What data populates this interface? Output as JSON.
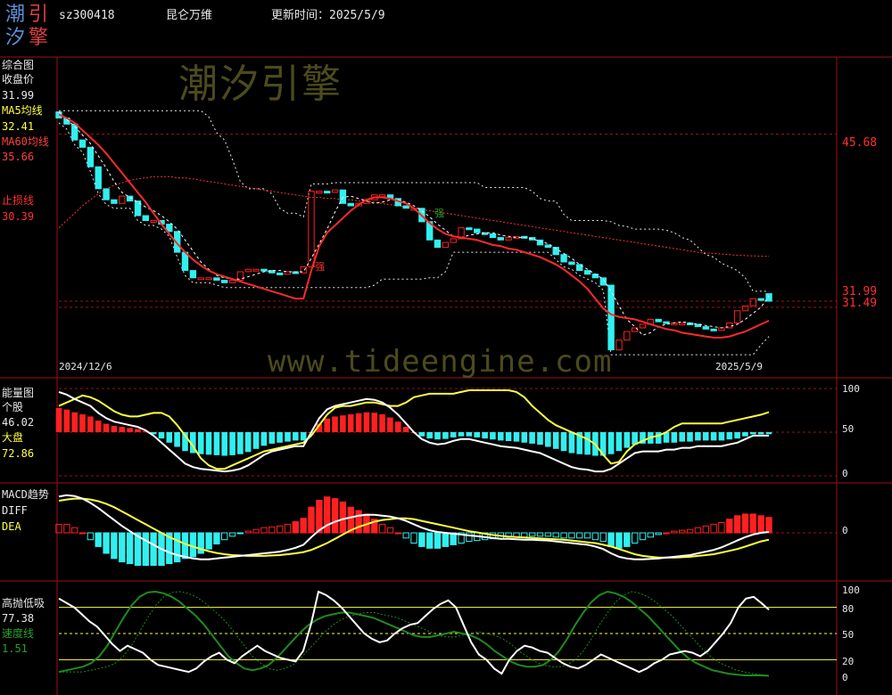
{
  "header": {
    "logo_chars": [
      "潮",
      "引",
      "汐",
      "擎"
    ],
    "code": "sz300418",
    "name": "昆仑万维",
    "update_label": "更新时间：2025/5/9"
  },
  "watermarks": {
    "brand": "潮汐引擎",
    "url": "www.tideengine.com"
  },
  "colors": {
    "up": "#ff2020",
    "down": "#30f0f0",
    "ma5": "#ffffff",
    "ma60": "#ff3030",
    "stop": "#ff2a2a",
    "yellow": "#ffff40",
    "green": "#1f8a1f",
    "grid": "#a01010"
  },
  "panels": {
    "main": {
      "title": "综合图",
      "close_label": "收盘价",
      "close_value": "31.99",
      "ma5_label": "MA5均线",
      "ma5_value": "32.41",
      "ma60_label": "MA60均线",
      "ma60_value": "35.66",
      "stop_label": "止损线",
      "stop_value": "30.39",
      "date_start": "2024/12/6",
      "date_end": "2025/5/9",
      "axis_labels": [
        "45.68",
        "31.99",
        "31.49"
      ],
      "markers": [
        "强",
        "强"
      ]
    },
    "energy": {
      "title": "能量图",
      "stock_label": "个股",
      "stock_value": "46.02",
      "market_label": "大盘",
      "market_value": "72.86",
      "axis_labels": [
        "100",
        "50",
        "0"
      ]
    },
    "macd": {
      "title": "MACD趋势",
      "diff_label": "DIFF",
      "dea_label": "DEA",
      "axis_labels": [
        "0"
      ]
    },
    "osc": {
      "title": "高抛低吸",
      "value": "77.38",
      "speed_label": "速度线",
      "speed_value": "1.51",
      "axis_labels": [
        "100",
        "80",
        "50",
        "20",
        "0"
      ]
    }
  },
  "chart_data": [
    {
      "type": "candlestick",
      "title": "综合图",
      "x_start": "2024/12/6",
      "x_end": "2025/5/9",
      "ylim": [
        26,
        52
      ],
      "reference_levels": [
        45.68,
        31.99,
        31.49
      ],
      "close": [
        47.0,
        46.5,
        45.2,
        44.6,
        43.0,
        41.2,
        40.3,
        40.0,
        40.6,
        40.2,
        39.0,
        38.6,
        38.6,
        38.3,
        37.7,
        36.0,
        34.5,
        33.9,
        33.9,
        33.9,
        33.7,
        33.5,
        33.7,
        34.4,
        34.6,
        34.6,
        34.5,
        34.3,
        34.2,
        34.4,
        34.3,
        34.8,
        41.0,
        41.0,
        40.9,
        41.1,
        40.0,
        39.8,
        40.0,
        40.3,
        40.7,
        40.7,
        40.4,
        39.8,
        39.6,
        39.6,
        38.5,
        37.0,
        36.4,
        36.8,
        37.1,
        38.0,
        37.9,
        37.6,
        37.5,
        37.2,
        37.0,
        37.2,
        37.3,
        37.2,
        37.0,
        36.6,
        36.4,
        35.8,
        35.2,
        35.0,
        34.5,
        34.2,
        33.9,
        33.3,
        28.0,
        28.8,
        29.5,
        29.8,
        30.1,
        30.5,
        30.3,
        30.2,
        30.2,
        30.2,
        30.1,
        29.9,
        29.7,
        29.6,
        29.8,
        30.2,
        31.2,
        31.6,
        32.2,
        32.1,
        31.99
      ],
      "open": [
        47.5,
        47.0,
        46.5,
        45.2,
        44.6,
        43.0,
        41.2,
        40.3,
        40.0,
        40.6,
        40.2,
        39.0,
        38.6,
        38.6,
        38.3,
        37.7,
        36.0,
        34.5,
        33.9,
        33.9,
        33.9,
        33.7,
        33.5,
        33.7,
        34.4,
        34.6,
        34.6,
        34.5,
        34.3,
        34.2,
        34.4,
        34.3,
        34.8,
        41.0,
        41.0,
        40.9,
        41.1,
        40.0,
        39.8,
        40.0,
        40.3,
        40.7,
        40.7,
        40.4,
        39.8,
        39.6,
        39.6,
        38.5,
        37.0,
        36.4,
        36.8,
        37.1,
        38.0,
        37.9,
        37.6,
        37.5,
        37.2,
        37.0,
        37.2,
        37.3,
        37.2,
        37.0,
        36.6,
        36.4,
        35.8,
        35.2,
        35.0,
        34.5,
        34.2,
        33.9,
        33.3,
        28.0,
        28.8,
        29.5,
        29.8,
        30.1,
        30.5,
        30.3,
        30.2,
        30.2,
        30.2,
        30.1,
        29.9,
        29.7,
        29.6,
        29.8,
        30.2,
        31.2,
        31.6,
        32.2,
        32.6
      ],
      "series": [
        {
          "name": "MA5均线",
          "values": [
            47.5,
            46.9,
            46.3,
            45.6,
            44.9,
            43.9,
            42.9,
            41.8,
            40.9,
            40.5,
            40.1,
            39.7,
            39.4,
            39.0,
            38.5,
            37.9,
            37.0,
            36.1,
            35.2,
            34.6,
            34.1,
            33.9,
            33.8,
            33.8,
            34.0,
            34.2,
            34.4,
            34.5,
            34.5,
            34.4,
            34.4,
            34.4,
            35.5,
            36.7,
            37.9,
            39.3,
            40.5,
            40.6,
            40.4,
            40.2,
            40.0,
            40.1,
            40.3,
            40.3,
            40.1,
            39.8,
            39.4,
            38.9,
            38.3,
            37.8,
            37.3,
            37.2,
            37.4,
            37.5,
            37.6,
            37.6,
            37.4,
            37.3,
            37.2,
            37.2,
            37.1,
            36.9,
            36.7,
            36.3,
            35.9,
            35.5,
            35.0,
            34.6,
            34.2,
            33.8,
            32.8,
            31.6,
            30.5,
            29.9,
            29.2,
            29.4,
            29.9,
            30.1,
            30.2,
            30.3,
            30.2,
            30.1,
            30.0,
            29.9,
            29.8,
            29.9,
            30.1,
            30.5,
            31.0,
            31.5,
            32.41
          ]
        },
        {
          "name": "MA60均线",
          "values": [
            38.0,
            38.6,
            39.2,
            39.8,
            40.3,
            40.8,
            41.2,
            41.5,
            41.7,
            41.9,
            42.0,
            42.1,
            42.2,
            42.2,
            42.2,
            42.1,
            42.1,
            42.0,
            41.9,
            41.8,
            41.7,
            41.6,
            41.5,
            41.4,
            41.3,
            41.2,
            41.1,
            41.0,
            40.9,
            40.8,
            40.7,
            40.6,
            40.5,
            40.5,
            40.4,
            40.4,
            40.3,
            40.3,
            40.2,
            40.2,
            40.1,
            40.0,
            39.9,
            39.8,
            39.7,
            39.6,
            39.5,
            39.4,
            39.3,
            39.2,
            39.1,
            39.0,
            38.9,
            38.8,
            38.7,
            38.6,
            38.5,
            38.4,
            38.3,
            38.2,
            38.1,
            38.0,
            37.9,
            37.8,
            37.7,
            37.6,
            37.5,
            37.4,
            37.3,
            37.2,
            37.1,
            37.0,
            36.9,
            36.8,
            36.7,
            36.6,
            36.5,
            36.4,
            36.3,
            36.2,
            36.1,
            36.0,
            35.95,
            35.9,
            35.85,
            35.8,
            35.75,
            35.72,
            35.7,
            35.68,
            35.66
          ]
        },
        {
          "name": "止损线",
          "values": [
            47.3,
            47.0,
            46.6,
            46.0,
            45.4,
            44.8,
            44.1,
            43.3,
            42.5,
            41.7,
            40.9,
            40.1,
            39.2,
            38.3,
            37.5,
            36.7,
            36.0,
            35.4,
            34.9,
            34.5,
            34.2,
            34.0,
            33.8,
            33.6,
            33.4,
            33.2,
            33.0,
            32.8,
            32.6,
            32.4,
            32.2,
            32.2,
            34.5,
            36.5,
            37.6,
            38.2,
            38.8,
            39.4,
            39.9,
            40.3,
            40.5,
            40.5,
            40.4,
            40.2,
            40.0,
            39.6,
            39.0,
            38.4,
            37.9,
            37.5,
            37.3,
            37.2,
            37.1,
            37.0,
            36.8,
            36.6,
            36.5,
            36.3,
            36.2,
            36.0,
            35.8,
            35.6,
            35.3,
            35.0,
            34.6,
            34.1,
            33.6,
            33.0,
            32.2,
            31.4,
            30.9,
            30.7,
            30.6,
            30.5,
            30.3,
            30.1,
            29.9,
            29.7,
            29.6,
            29.4,
            29.3,
            29.2,
            29.1,
            29.0,
            29.0,
            29.1,
            29.3,
            29.5,
            29.8,
            30.1,
            30.39
          ]
        }
      ]
    },
    {
      "type": "bar",
      "title": "能量图",
      "ylim": [
        0,
        100
      ],
      "series": [
        {
          "name": "个股",
          "values": [
            96,
            93,
            88,
            84,
            80,
            72,
            66,
            62,
            60,
            58,
            56,
            52,
            46,
            38,
            30,
            22,
            14,
            10,
            8,
            7,
            6,
            5,
            6,
            8,
            12,
            18,
            24,
            28,
            30,
            32,
            34,
            34,
            50,
            66,
            76,
            80,
            82,
            84,
            86,
            88,
            87,
            84,
            78,
            70,
            60,
            50,
            42,
            38,
            36,
            37,
            40,
            42,
            42,
            40,
            38,
            36,
            34,
            33,
            32,
            30,
            28,
            26,
            22,
            18,
            14,
            10,
            8,
            7,
            5,
            5,
            8,
            14,
            20,
            26,
            28,
            28,
            28,
            30,
            30,
            32,
            32,
            34,
            34,
            34,
            34,
            36,
            38,
            42,
            46,
            46,
            46.02
          ]
        },
        {
          "name": "大盘",
          "values": [
            80,
            84,
            88,
            92,
            90,
            86,
            80,
            74,
            70,
            68,
            68,
            70,
            72,
            72,
            68,
            58,
            46,
            34,
            20,
            12,
            8,
            8,
            12,
            16,
            20,
            24,
            28,
            30,
            32,
            34,
            36,
            38,
            46,
            58,
            70,
            78,
            80,
            80,
            82,
            84,
            84,
            82,
            80,
            80,
            84,
            90,
            92,
            94,
            94,
            94,
            94,
            96,
            98,
            98,
            98,
            98,
            98,
            98,
            96,
            90,
            80,
            72,
            64,
            58,
            54,
            50,
            46,
            42,
            36,
            24,
            14,
            16,
            28,
            36,
            40,
            44,
            46,
            50,
            56,
            60,
            60,
            60,
            60,
            60,
            60,
            62,
            64,
            66,
            68,
            70,
            72.86
          ]
        }
      ]
    },
    {
      "type": "bar",
      "title": "MACD趋势",
      "ylim": [
        -1.0,
        1.0
      ],
      "series": [
        {
          "name": "DIFF",
          "values": [
            0.85,
            0.88,
            0.86,
            0.8,
            0.7,
            0.58,
            0.44,
            0.3,
            0.16,
            0.04,
            -0.08,
            -0.18,
            -0.28,
            -0.38,
            -0.46,
            -0.52,
            -0.56,
            -0.6,
            -0.62,
            -0.62,
            -0.6,
            -0.58,
            -0.56,
            -0.54,
            -0.52,
            -0.5,
            -0.48,
            -0.46,
            -0.44,
            -0.4,
            -0.35,
            -0.28,
            -0.1,
            0.06,
            0.18,
            0.26,
            0.32,
            0.36,
            0.4,
            0.42,
            0.42,
            0.4,
            0.38,
            0.34,
            0.28,
            0.2,
            0.12,
            0.06,
            0.02,
            0.0,
            -0.02,
            -0.04,
            -0.06,
            -0.08,
            -0.1,
            -0.12,
            -0.14,
            -0.14,
            -0.15,
            -0.16,
            -0.16,
            -0.17,
            -0.18,
            -0.2,
            -0.22,
            -0.24,
            -0.26,
            -0.28,
            -0.32,
            -0.38,
            -0.48,
            -0.56,
            -0.6,
            -0.62,
            -0.62,
            -0.61,
            -0.6,
            -0.58,
            -0.56,
            -0.54,
            -0.52,
            -0.48,
            -0.44,
            -0.4,
            -0.34,
            -0.26,
            -0.18,
            -0.1,
            -0.04,
            0.0,
            0.02
          ]
        },
        {
          "name": "DEA",
          "values": [
            0.75,
            0.78,
            0.8,
            0.8,
            0.78,
            0.74,
            0.68,
            0.6,
            0.5,
            0.4,
            0.3,
            0.2,
            0.1,
            0.0,
            -0.1,
            -0.18,
            -0.26,
            -0.32,
            -0.38,
            -0.43,
            -0.47,
            -0.5,
            -0.52,
            -0.53,
            -0.54,
            -0.54,
            -0.54,
            -0.53,
            -0.52,
            -0.5,
            -0.48,
            -0.45,
            -0.4,
            -0.32,
            -0.24,
            -0.14,
            -0.04,
            0.06,
            0.14,
            0.2,
            0.26,
            0.3,
            0.32,
            0.34,
            0.34,
            0.32,
            0.28,
            0.24,
            0.2,
            0.16,
            0.12,
            0.08,
            0.04,
            0.01,
            -0.02,
            -0.05,
            -0.07,
            -0.09,
            -0.1,
            -0.11,
            -0.12,
            -0.13,
            -0.14,
            -0.15,
            -0.16,
            -0.18,
            -0.2,
            -0.22,
            -0.24,
            -0.28,
            -0.32,
            -0.38,
            -0.44,
            -0.5,
            -0.54,
            -0.56,
            -0.58,
            -0.58,
            -0.58,
            -0.57,
            -0.56,
            -0.54,
            -0.52,
            -0.5,
            -0.46,
            -0.42,
            -0.38,
            -0.32,
            -0.26,
            -0.2,
            -0.16
          ]
        }
      ]
    },
    {
      "type": "line",
      "title": "高抛低吸",
      "ylim": [
        0,
        100
      ],
      "reference_levels": [
        80,
        50,
        20
      ],
      "series": [
        {
          "name": "高抛低吸",
          "values": [
            90,
            85,
            80,
            72,
            64,
            58,
            48,
            38,
            30,
            36,
            32,
            28,
            20,
            14,
            12,
            10,
            8,
            6,
            10,
            18,
            24,
            28,
            20,
            16,
            24,
            30,
            36,
            30,
            26,
            22,
            20,
            18,
            30,
            60,
            98,
            94,
            88,
            80,
            70,
            60,
            50,
            44,
            40,
            42,
            50,
            56,
            60,
            62,
            70,
            78,
            84,
            88,
            80,
            60,
            40,
            26,
            20,
            10,
            4,
            20,
            30,
            36,
            34,
            30,
            28,
            22,
            16,
            12,
            10,
            14,
            20,
            26,
            22,
            18,
            14,
            10,
            6,
            10,
            16,
            20,
            26,
            28,
            30,
            28,
            24,
            30,
            40,
            50,
            62,
            80,
            90,
            92,
            85,
            77.38
          ]
        },
        {
          "name": "速度线",
          "values": [
            6,
            8,
            10,
            12,
            16,
            24,
            36,
            52,
            68,
            82,
            92,
            97,
            98,
            96,
            92,
            86,
            78,
            70,
            60,
            48,
            36,
            24,
            16,
            10,
            8,
            10,
            14,
            22,
            32,
            42,
            52,
            60,
            66,
            70,
            72,
            74,
            74,
            72,
            70,
            68,
            64,
            60,
            56,
            52,
            48,
            46,
            46,
            48,
            50,
            52,
            50,
            48,
            44,
            38,
            30,
            24,
            18,
            14,
            12,
            12,
            14,
            20,
            30,
            44,
            60,
            74,
            86,
            94,
            98,
            96,
            92,
            86,
            78,
            70,
            60,
            50,
            40,
            30,
            22,
            16,
            12,
            8,
            6,
            4,
            3,
            2,
            2,
            2,
            1.51
          ]
        }
      ]
    }
  ]
}
